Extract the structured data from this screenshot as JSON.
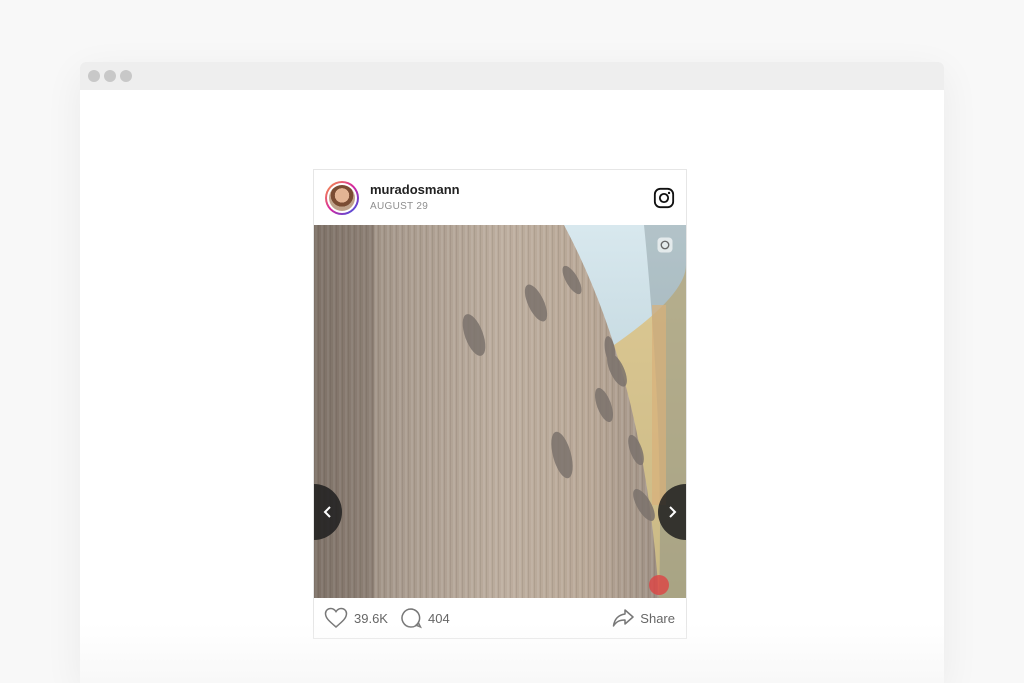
{
  "window": {
    "controls": [
      "close",
      "minimize",
      "maximize"
    ]
  },
  "post": {
    "username": "muradosmann",
    "date": "AUGUST 29",
    "platform_icon": "instagram-icon",
    "media_icon": "camera-icon",
    "likes": "39.6K",
    "comments": "404",
    "share_label": "Share"
  },
  "colors": {
    "background": "#f8f8f8",
    "titlebar": "#eeeeee",
    "muted_text": "#8e8e8e"
  }
}
